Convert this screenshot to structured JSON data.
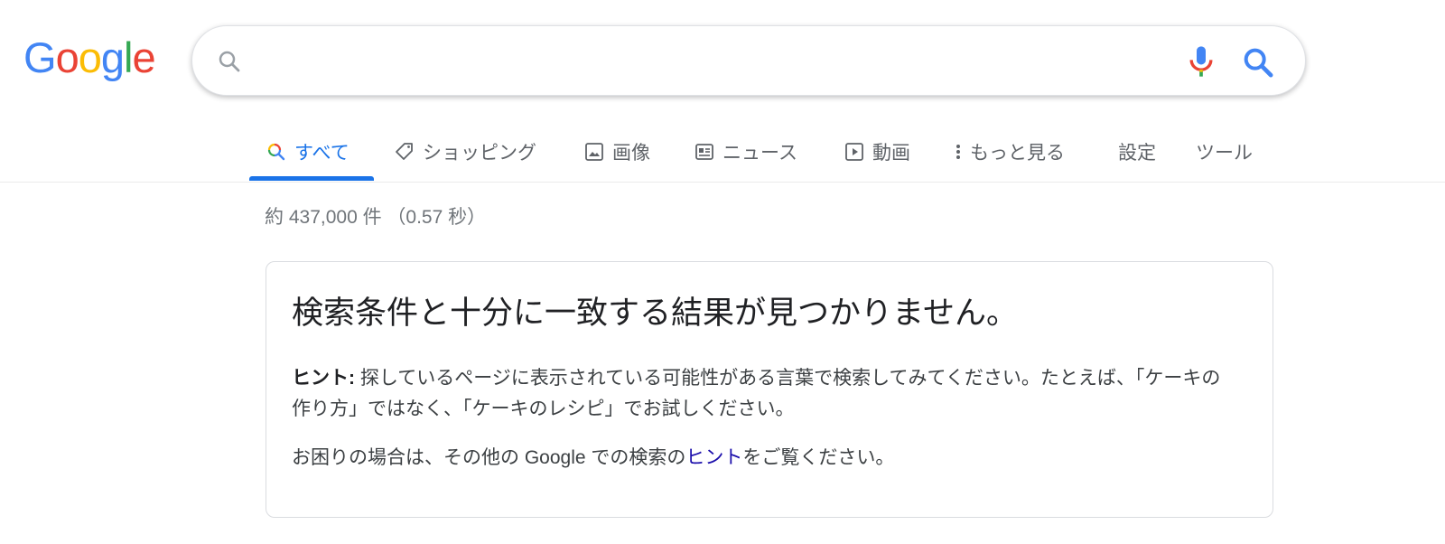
{
  "logo": {
    "letters": [
      "G",
      "o",
      "o",
      "g",
      "l",
      "e"
    ],
    "colors": [
      "#4285F4",
      "#EA4335",
      "#FBBC05",
      "#4285F4",
      "#34A853",
      "#EA4335"
    ]
  },
  "search": {
    "value": "",
    "placeholder": ""
  },
  "tabs": [
    {
      "label": "すべて",
      "icon": "search-icon",
      "active": true
    },
    {
      "label": "ショッピング",
      "icon": "tag-icon",
      "active": false
    },
    {
      "label": "画像",
      "icon": "image-icon",
      "active": false
    },
    {
      "label": "ニュース",
      "icon": "news-icon",
      "active": false
    },
    {
      "label": "動画",
      "icon": "video-icon",
      "active": false
    },
    {
      "label": "もっと見る",
      "icon": "more-vert-icon",
      "active": false
    },
    {
      "label": "設定",
      "icon": "",
      "active": false
    },
    {
      "label": "ツール",
      "icon": "",
      "active": false
    }
  ],
  "stats": "約 437,000 件 （0.57 秒）",
  "no_results": {
    "title": "検索条件と十分に一致する結果が見つかりません。",
    "hint_label": "ヒント:",
    "hint_text": " 探しているページに表示されている可能性がある言葉で検索してみてください。たとえば、「ケーキの作り方」ではなく、「ケーキのレシピ」でお試しください。",
    "more_prefix": "お困りの場合は、その他の Google での検索の",
    "more_link": "ヒント",
    "more_suffix": "をご覧ください。"
  },
  "colors": {
    "accent": "#1a73e8",
    "link": "#1a0dab"
  }
}
